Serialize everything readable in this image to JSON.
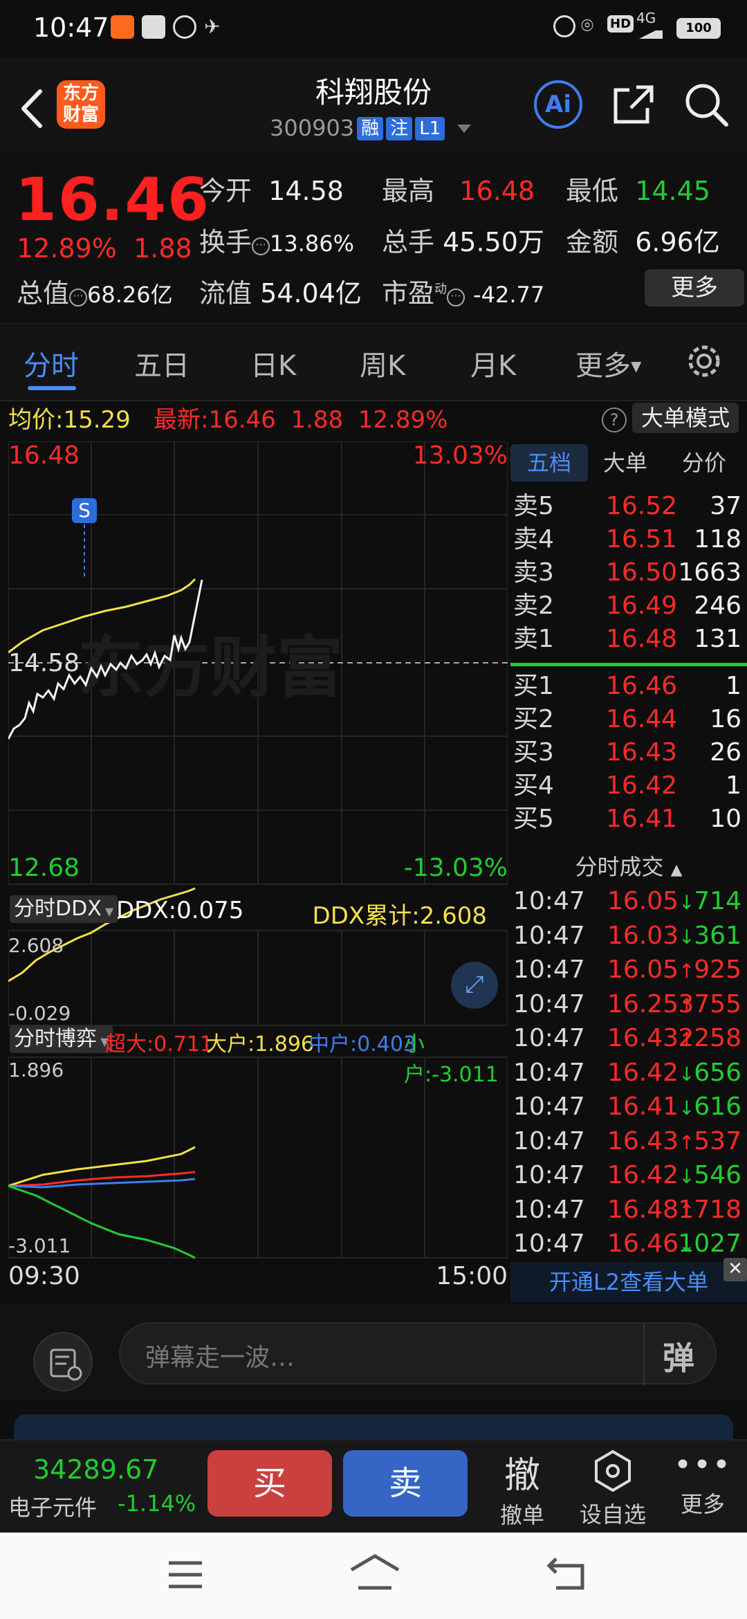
{
  "status_bar": {
    "time": "10:47",
    "battery": "100",
    "network": "4G"
  },
  "header": {
    "logo_text_line1": "东方",
    "logo_text_line2": "财富",
    "title": "科翔股份",
    "code": "300903",
    "tags": [
      "融",
      "注",
      "L1"
    ],
    "ai_label": "Ai"
  },
  "quote": {
    "price": "16.46",
    "change_pct": "12.89%",
    "change_abs": "1.88",
    "open_label": "今开",
    "open_value": "14.58",
    "high_label": "最高",
    "high_value": "16.48",
    "low_label": "最低",
    "low_value": "14.45",
    "turnover_label": "换手",
    "turnover_value": "13.86%",
    "volume_label": "总手",
    "volume_value": "45.50万",
    "amount_label": "金额",
    "amount_value": "6.96亿",
    "mktcap_label": "总值",
    "mktcap_value": "68.26亿",
    "float_label": "流值",
    "float_value": "54.04亿",
    "pe_label": "市盈",
    "pe_sup": "动",
    "pe_value": "-42.77",
    "more_label": "更多"
  },
  "tabs": [
    "分时",
    "五日",
    "日K",
    "周K",
    "月K",
    "更多"
  ],
  "avg_bar": {
    "avg_label": "均价:",
    "avg_value": "15.29",
    "latest_label": "最新:",
    "latest_value": "16.46",
    "latest_chg": "1.88",
    "latest_pct": "12.89%",
    "mode_label": "大单模式"
  },
  "chart": {
    "top_price": "16.48",
    "top_pct": "13.03%",
    "mid_price": "14.58",
    "bottom_price": "12.68",
    "bottom_pct": "-13.03%",
    "marker": "S",
    "watermark": "东方财富",
    "ddx_selector": "分时DDX",
    "ddx_label": "DDX:0.075",
    "ddx_cum": "DDX累计:2.608",
    "ddx_top": "2.608",
    "ddx_bottom": "-0.029",
    "game_selector": "分时博弈",
    "super_label": "超大:0.711",
    "large_label": "大户:1.896",
    "mid_label": "中户:0.403",
    "small_label": "小户:-3.011",
    "game_top": "1.896",
    "game_bottom": "-3.011",
    "time_start": "09:30",
    "time_end": "15:00"
  },
  "orderbook": {
    "tabs": [
      "五档",
      "大单",
      "分价"
    ],
    "asks": [
      {
        "label": "卖5",
        "price": "16.52",
        "vol": "37"
      },
      {
        "label": "卖4",
        "price": "16.51",
        "vol": "118"
      },
      {
        "label": "卖3",
        "price": "16.50",
        "vol": "1663"
      },
      {
        "label": "卖2",
        "price": "16.49",
        "vol": "246"
      },
      {
        "label": "卖1",
        "price": "16.48",
        "vol": "131"
      }
    ],
    "bids": [
      {
        "label": "买1",
        "price": "16.46",
        "vol": "1"
      },
      {
        "label": "买2",
        "price": "16.44",
        "vol": "16"
      },
      {
        "label": "买3",
        "price": "16.43",
        "vol": "26"
      },
      {
        "label": "买4",
        "price": "16.42",
        "vol": "1"
      },
      {
        "label": "买5",
        "price": "16.41",
        "vol": "10"
      }
    ],
    "trades_title": "分时成交",
    "trades": [
      {
        "time": "10:47",
        "price": "16.05",
        "dir": "↓",
        "vol": "714"
      },
      {
        "time": "10:47",
        "price": "16.03",
        "dir": "↓",
        "vol": "361"
      },
      {
        "time": "10:47",
        "price": "16.05",
        "dir": "↑",
        "vol": "925"
      },
      {
        "time": "10:47",
        "price": "16.25",
        "dir": "↑",
        "vol": "3755"
      },
      {
        "time": "10:47",
        "price": "16.43",
        "dir": "↑",
        "vol": "2258"
      },
      {
        "time": "10:47",
        "price": "16.42",
        "dir": "↓",
        "vol": "656"
      },
      {
        "time": "10:47",
        "price": "16.41",
        "dir": "↓",
        "vol": "616"
      },
      {
        "time": "10:47",
        "price": "16.43",
        "dir": "↑",
        "vol": "537"
      },
      {
        "time": "10:47",
        "price": "16.42",
        "dir": "↓",
        "vol": "546"
      },
      {
        "time": "10:47",
        "price": "16.48",
        "dir": "↑",
        "vol": "1718"
      },
      {
        "time": "10:47",
        "price": "16.46",
        "dir": "↓",
        "vol": "1027"
      }
    ],
    "l2_banner": "开通L2查看大单"
  },
  "comment": {
    "placeholder": "弹幕走一波…",
    "danmu_label": "弹"
  },
  "bottom": {
    "index_value": "34289.67",
    "index_name": "电子元件",
    "index_pct": "-1.14%",
    "buy_label": "买",
    "sell_label": "卖",
    "cancel_big": "撤",
    "cancel_label": "撤单",
    "watch_label": "设自选",
    "more_label": "更多"
  },
  "colors": {
    "up": "#ff2a2a",
    "down": "#22cc33",
    "accent": "#4a8df7",
    "avg": "#f5e04a"
  }
}
